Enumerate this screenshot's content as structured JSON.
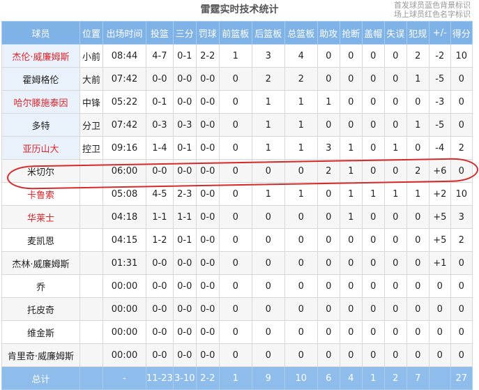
{
  "header": {
    "title": "雷霆实时技术统计",
    "note_line1": "首发球员蓝色背景标识",
    "note_line2": "场上球员红色名字标识"
  },
  "columns": [
    "球员",
    "位置",
    "出场时间",
    "投篮",
    "三分",
    "罚球",
    "前篮板",
    "后篮板",
    "总篮板",
    "助攻",
    "抢断",
    "盖帽",
    "失误",
    "犯规",
    "+/-",
    "得分"
  ],
  "players": [
    {
      "name": "杰伦·威廉姆斯",
      "pos": "小前",
      "min": "08:44",
      "fg": "4-7",
      "three": "0-1",
      "ft": "2-2",
      "oreb": "1",
      "dreb": "3",
      "reb": "4",
      "ast": "0",
      "stl": "0",
      "blk": "0",
      "tov": "0",
      "pf": "2",
      "pm": "-2",
      "pts": "10"
    },
    {
      "name": "霍姆格伦",
      "pos": "大前",
      "min": "07:42",
      "fg": "0-0",
      "three": "0-0",
      "ft": "0-0",
      "oreb": "0",
      "dreb": "2",
      "reb": "2",
      "ast": "0",
      "stl": "0",
      "blk": "0",
      "tov": "0",
      "pf": "1",
      "pm": "-5",
      "pts": "0"
    },
    {
      "name": "哈尔滕施泰因",
      "pos": "中锋",
      "min": "05:22",
      "fg": "0-1",
      "three": "0-0",
      "ft": "0-0",
      "oreb": "0",
      "dreb": "1",
      "reb": "1",
      "ast": "1",
      "stl": "0",
      "blk": "0",
      "tov": "0",
      "pf": "0",
      "pm": "-3",
      "pts": "0"
    },
    {
      "name": "多特",
      "pos": "分卫",
      "min": "07:42",
      "fg": "0-3",
      "three": "0-3",
      "ft": "0-0",
      "oreb": "0",
      "dreb": "1",
      "reb": "1",
      "ast": "0",
      "stl": "0",
      "blk": "0",
      "tov": "0",
      "pf": "1",
      "pm": "-5",
      "pts": "0"
    },
    {
      "name": "亚历山大",
      "pos": "控卫",
      "min": "09:16",
      "fg": "1-4",
      "three": "0-1",
      "ft": "0-0",
      "oreb": "0",
      "dreb": "1",
      "reb": "1",
      "ast": "3",
      "stl": "1",
      "blk": "0",
      "tov": "1",
      "pf": "0",
      "pm": "-4",
      "pts": "2"
    },
    {
      "name": "米切尔",
      "pos": "",
      "min": "06:00",
      "fg": "0-0",
      "three": "0-0",
      "ft": "0-0",
      "oreb": "0",
      "dreb": "0",
      "reb": "0",
      "ast": "2",
      "stl": "1",
      "blk": "0",
      "tov": "0",
      "pf": "2",
      "pm": "+6",
      "pts": "0"
    },
    {
      "name": "卡鲁索",
      "pos": "",
      "min": "05:08",
      "fg": "4-5",
      "three": "2-3",
      "ft": "0-0",
      "oreb": "0",
      "dreb": "1",
      "reb": "1",
      "ast": "0",
      "stl": "1",
      "blk": "1",
      "tov": "1",
      "pf": "1",
      "pm": "+2",
      "pts": "10"
    },
    {
      "name": "华莱士",
      "pos": "",
      "min": "04:18",
      "fg": "1-1",
      "three": "1-1",
      "ft": "0-0",
      "oreb": "0",
      "dreb": "0",
      "reb": "0",
      "ast": "0",
      "stl": "1",
      "blk": "0",
      "tov": "0",
      "pf": "0",
      "pm": "+5",
      "pts": "3"
    },
    {
      "name": "麦凯恩",
      "pos": "",
      "min": "04:15",
      "fg": "1-2",
      "three": "0-1",
      "ft": "0-0",
      "oreb": "0",
      "dreb": "0",
      "reb": "0",
      "ast": "0",
      "stl": "0",
      "blk": "0",
      "tov": "0",
      "pf": "0",
      "pm": "+5",
      "pts": "2"
    },
    {
      "name": "杰林·威廉姆斯",
      "pos": "",
      "min": "01:31",
      "fg": "0-0",
      "three": "0-0",
      "ft": "0-0",
      "oreb": "0",
      "dreb": "0",
      "reb": "0",
      "ast": "0",
      "stl": "0",
      "blk": "0",
      "tov": "0",
      "pf": "0",
      "pm": "+1",
      "pts": "0"
    },
    {
      "name": "乔",
      "pos": "",
      "min": "00:00",
      "fg": "0-0",
      "three": "0-0",
      "ft": "0-0",
      "oreb": "0",
      "dreb": "0",
      "reb": "0",
      "ast": "0",
      "stl": "0",
      "blk": "0",
      "tov": "0",
      "pf": "0",
      "pm": "0",
      "pts": "0"
    },
    {
      "name": "托皮奇",
      "pos": "",
      "min": "00:00",
      "fg": "0-0",
      "three": "0-0",
      "ft": "0-0",
      "oreb": "0",
      "dreb": "0",
      "reb": "0",
      "ast": "0",
      "stl": "0",
      "blk": "0",
      "tov": "0",
      "pf": "0",
      "pm": "0",
      "pts": "0"
    },
    {
      "name": "维金斯",
      "pos": "",
      "min": "00:00",
      "fg": "0-0",
      "three": "0-0",
      "ft": "0-0",
      "oreb": "0",
      "dreb": "0",
      "reb": "0",
      "ast": "0",
      "stl": "0",
      "blk": "0",
      "tov": "0",
      "pf": "0",
      "pm": "0",
      "pts": "0"
    },
    {
      "name": "肯里奇·威廉姆斯",
      "pos": "",
      "min": "00:00",
      "fg": "0-0",
      "three": "0-0",
      "ft": "0-0",
      "oreb": "0",
      "dreb": "0",
      "reb": "0",
      "ast": "0",
      "stl": "0",
      "blk": "0",
      "tov": "0",
      "pf": "0",
      "pm": "0",
      "pts": "0"
    }
  ],
  "totals": {
    "name": "总计",
    "pos": "",
    "min": "-",
    "fg": "11-23",
    "three": "3-10",
    "ft": "2-2",
    "oreb": "1",
    "dreb": "9",
    "reb": "10",
    "ast": "6",
    "stl": "4",
    "blk": "1",
    "tov": "2",
    "pf": "7",
    "pm": "",
    "pts": "27"
  },
  "starters": [
    "杰伦·威廉姆斯",
    "霍姆格伦",
    "哈尔滕施泰因",
    "多特",
    "亚历山大"
  ],
  "on_court": [
    "杰伦·威廉姆斯",
    "哈尔滕施泰因",
    "亚历山大",
    "卡鲁索",
    "华莱士"
  ],
  "colors": {
    "header_bg": "#7fb2e6",
    "starter_bg": "#e9f1fb",
    "on_court_text": "#e0242a",
    "annotation": "#d62828"
  },
  "annotation": {
    "type": "hand-drawn-circle",
    "highlighted_player": "卡鲁索"
  }
}
